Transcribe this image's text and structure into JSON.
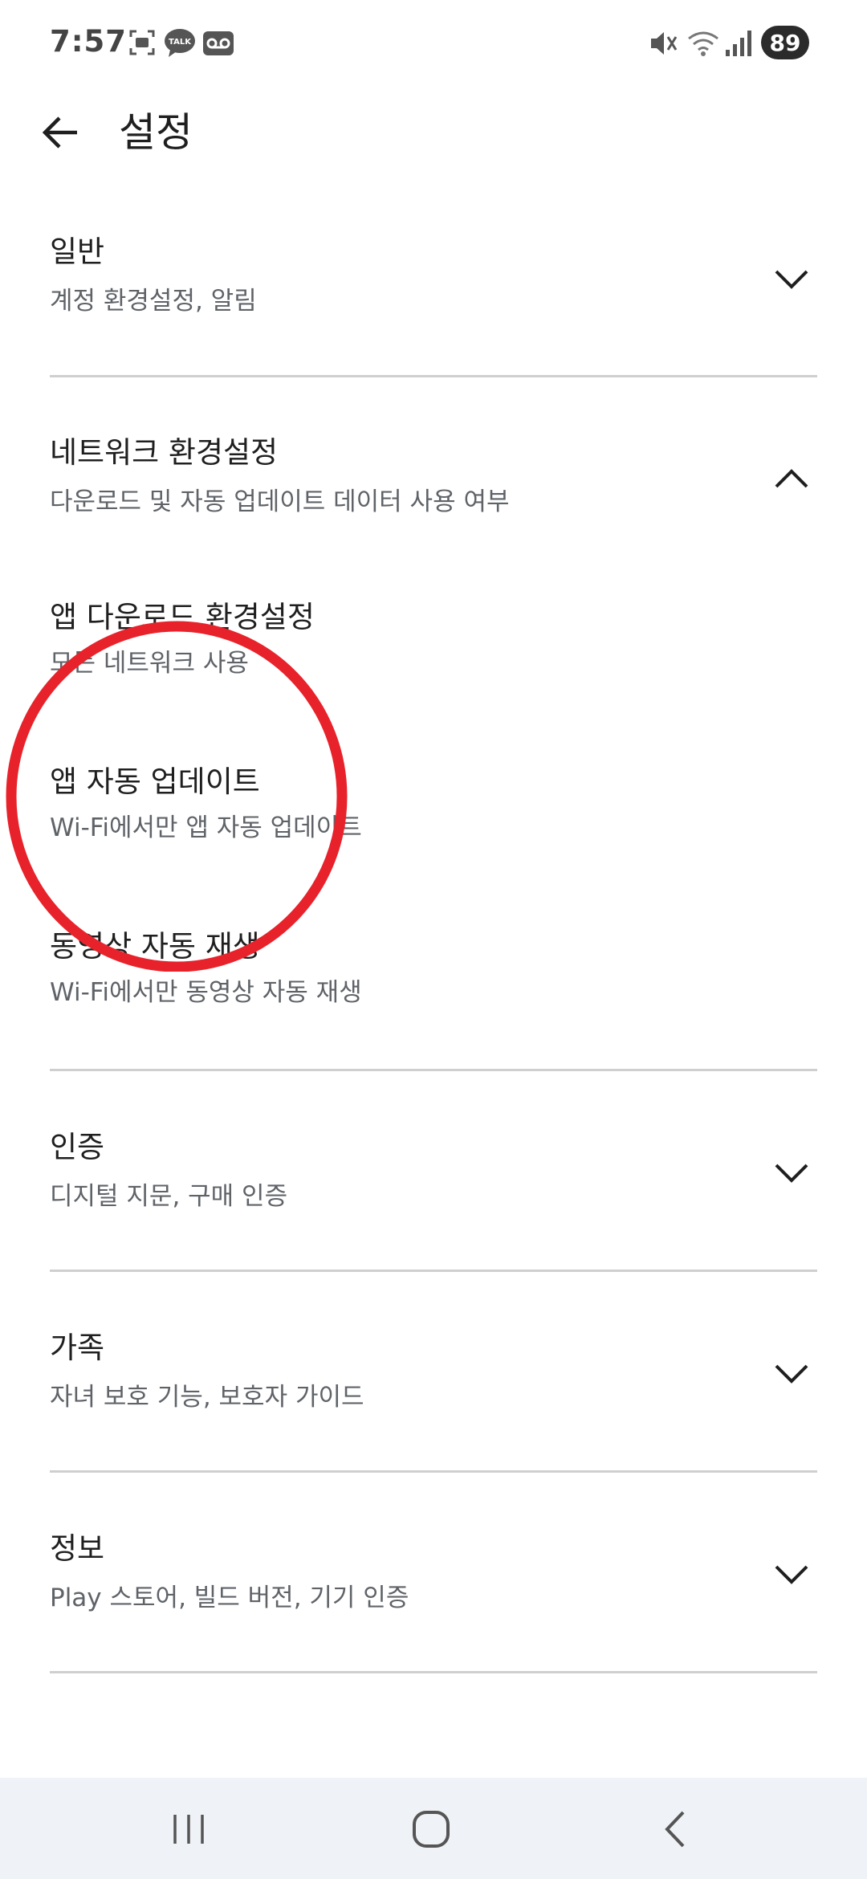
{
  "status_bar": {
    "time": "7:57",
    "battery": "89",
    "left_icons": [
      "screenshot-icon",
      "talk-icon",
      "voicemail-icon"
    ],
    "right_icons": [
      "mute-icon",
      "wifi-icon",
      "signal-icon"
    ],
    "talk_label": "TALK"
  },
  "app_bar": {
    "title": "설정",
    "back_icon": "arrow-back-icon"
  },
  "sections": [
    {
      "title": "일반",
      "subtitle": "계정 환경설정, 알림",
      "expanded": false
    },
    {
      "title": "네트워크 환경설정",
      "subtitle": "다운로드 및 자동 업데이트 데이터 사용 여부",
      "expanded": true,
      "items": [
        {
          "title": "앱 다운로드 환경설정",
          "subtitle": "모든 네트워크 사용"
        },
        {
          "title": "앱 자동 업데이트",
          "subtitle": "Wi-Fi에서만 앱 자동 업데이트"
        },
        {
          "title": "동영상 자동 재생",
          "subtitle": "Wi-Fi에서만 동영상 자동 재생"
        }
      ]
    },
    {
      "title": "인증",
      "subtitle": "디지털 지문, 구매 인증",
      "expanded": false
    },
    {
      "title": "가족",
      "subtitle": "자녀 보호 기능, 보호자 가이드",
      "expanded": false
    },
    {
      "title": "정보",
      "subtitle": "Play 스토어, 빌드 버전, 기기 인증",
      "expanded": false
    }
  ],
  "annotation_color": "#e8222b",
  "nav_bar": [
    "recents-icon",
    "home-icon",
    "back-icon"
  ]
}
